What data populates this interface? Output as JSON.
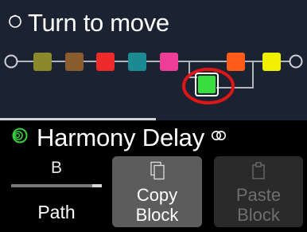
{
  "header": {
    "title": "Turn to move",
    "icon": "rotate-knob-icon"
  },
  "signal_chain": {
    "block_colors": [
      "#8a8a2c",
      "#8a5c2e",
      "#ee2b2b",
      "#1c8a93",
      "#ee3d96",
      "#38dd3e",
      "#ff5c1a",
      "#f2ee00"
    ],
    "selected_color": "#38dd3e",
    "highlight_ring_color": "#e01616"
  },
  "block": {
    "name": "Harmony Delay",
    "status_icon": "block-on-icon",
    "stereo_icon": "stereo-icon",
    "accent": "#34d23b"
  },
  "path": {
    "value": "B",
    "label": "Path",
    "level": 1.0
  },
  "buttons": {
    "copy": {
      "line1": "Copy",
      "line2": "Block",
      "icon": "copy-icon"
    },
    "paste": {
      "line1": "Paste",
      "line2": "Block",
      "icon": "paste-icon"
    }
  }
}
